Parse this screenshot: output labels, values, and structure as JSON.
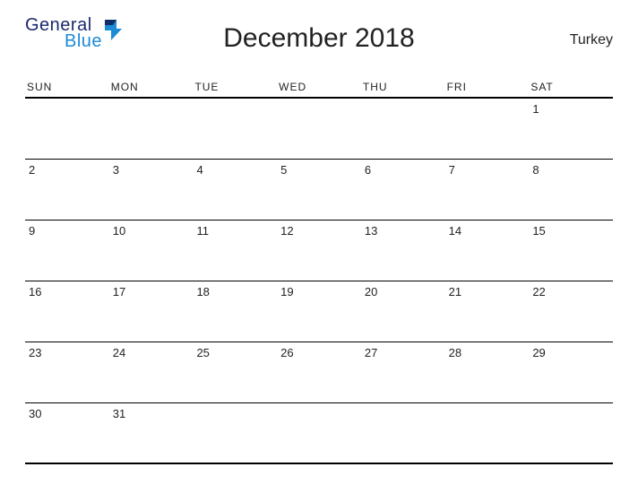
{
  "logo": {
    "general": "General",
    "blue": "Blue"
  },
  "title": "December 2018",
  "region": "Turkey",
  "daysOfWeek": [
    "SUN",
    "MON",
    "TUE",
    "WED",
    "THU",
    "FRI",
    "SAT"
  ],
  "weeks": [
    [
      "",
      "",
      "",
      "",
      "",
      "",
      "1"
    ],
    [
      "2",
      "3",
      "4",
      "5",
      "6",
      "7",
      "8"
    ],
    [
      "9",
      "10",
      "11",
      "12",
      "13",
      "14",
      "15"
    ],
    [
      "16",
      "17",
      "18",
      "19",
      "20",
      "21",
      "22"
    ],
    [
      "23",
      "24",
      "25",
      "26",
      "27",
      "28",
      "29"
    ],
    [
      "30",
      "31",
      "",
      "",
      "",
      "",
      ""
    ]
  ]
}
